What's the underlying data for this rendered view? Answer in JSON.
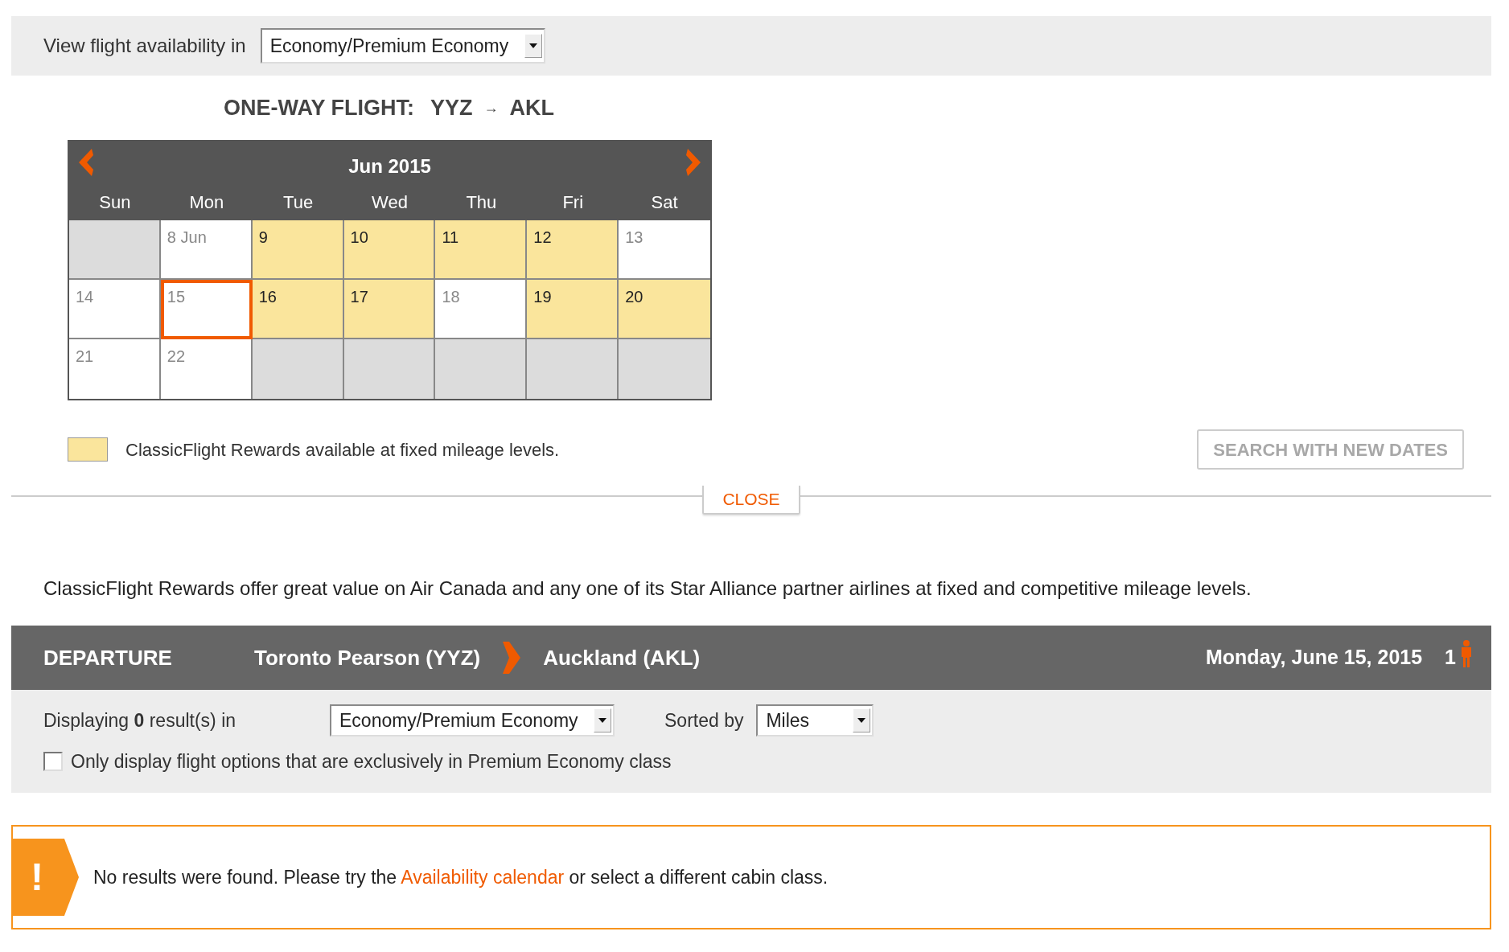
{
  "availability_bar": {
    "label": "View flight availability in",
    "cabin_select": "Economy/Premium Economy"
  },
  "flight_title": {
    "label": "ONE-WAY FLIGHT:",
    "origin": "YYZ",
    "arrow": "→",
    "destination": "AKL"
  },
  "calendar": {
    "month": "Jun 2015",
    "weekdays": [
      "Sun",
      "Mon",
      "Tue",
      "Wed",
      "Thu",
      "Fri",
      "Sat"
    ],
    "weeks": [
      [
        {
          "kind": "blank"
        },
        {
          "kind": "day",
          "label": "8 Jun",
          "available": false,
          "selected": false
        },
        {
          "kind": "day",
          "label": "9",
          "available": true,
          "selected": false
        },
        {
          "kind": "day",
          "label": "10",
          "available": true,
          "selected": false
        },
        {
          "kind": "day",
          "label": "11",
          "available": true,
          "selected": false
        },
        {
          "kind": "day",
          "label": "12",
          "available": true,
          "selected": false
        },
        {
          "kind": "day",
          "label": "13",
          "available": false,
          "selected": false
        }
      ],
      [
        {
          "kind": "day",
          "label": "14",
          "available": false,
          "selected": false
        },
        {
          "kind": "day",
          "label": "15",
          "available": false,
          "selected": true
        },
        {
          "kind": "day",
          "label": "16",
          "available": true,
          "selected": false
        },
        {
          "kind": "day",
          "label": "17",
          "available": true,
          "selected": false
        },
        {
          "kind": "day",
          "label": "18",
          "available": false,
          "selected": false
        },
        {
          "kind": "day",
          "label": "19",
          "available": true,
          "selected": false
        },
        {
          "kind": "day",
          "label": "20",
          "available": true,
          "selected": false
        }
      ],
      [
        {
          "kind": "day",
          "label": "21",
          "available": false,
          "selected": false
        },
        {
          "kind": "day",
          "label": "22",
          "available": false,
          "selected": false
        },
        {
          "kind": "blank"
        },
        {
          "kind": "blank"
        },
        {
          "kind": "blank"
        },
        {
          "kind": "blank"
        },
        {
          "kind": "blank"
        }
      ]
    ]
  },
  "legend": {
    "text": "ClassicFlight Rewards available at fixed mileage levels."
  },
  "search_button": {
    "label": "SEARCH WITH NEW DATES",
    "disabled": true
  },
  "close_tab": {
    "label": "CLOSE"
  },
  "intro": "ClassicFlight Rewards offer great value on Air Canada and any one of its Star Alliance partner airlines at fixed and competitive mileage levels.",
  "departure": {
    "heading": "DEPARTURE",
    "origin": "Toronto Pearson (YYZ)",
    "destination": "Auckland (AKL)",
    "date": "Monday, June 15, 2015",
    "passengers": "1"
  },
  "results": {
    "text": "Displaying **0** result(s) in",
    "cabin_select": "Economy/Premium Economy",
    "sort_label": "Sorted by",
    "sort_select": "Miles"
  },
  "premium_only": {
    "label": "Only display flight options that are exclusively in Premium Economy class",
    "checked": false
  },
  "alert": {
    "icon": "!",
    "before": "No results were found. Please try the",
    "link": "Availability calendar",
    "after": "or select a different cabin class."
  }
}
